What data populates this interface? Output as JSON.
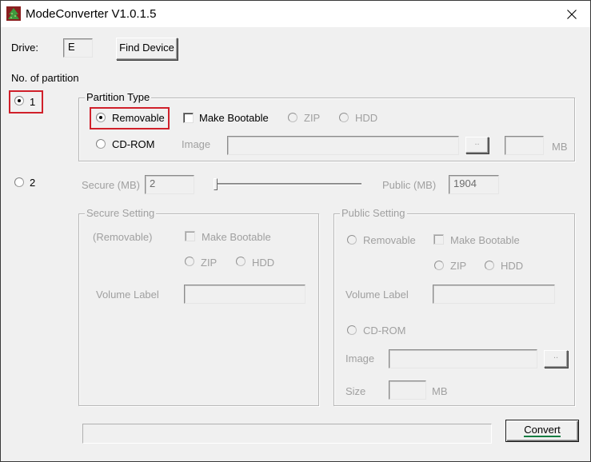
{
  "window": {
    "title": "ModeConverter V1.0.1.5",
    "app_icon": "tree-app-icon",
    "close_icon": "close-icon"
  },
  "drive": {
    "label": "Drive:",
    "value": "E",
    "find_device_label": "Find Device"
  },
  "partition_count": {
    "label": "No. of partition",
    "options": [
      {
        "label": "1",
        "checked": true
      },
      {
        "label": "2",
        "checked": false
      }
    ]
  },
  "partition_type": {
    "title": "Partition Type",
    "removable_label": "Removable",
    "removable_checked": true,
    "make_bootable_label": "Make Bootable",
    "make_bootable_checked": false,
    "zip_label": "ZIP",
    "hdd_label": "HDD",
    "cdrom_label": "CD-ROM",
    "cdrom_checked": false,
    "image_label": "Image",
    "image_value": "",
    "browse_label": "..",
    "size_value": "",
    "size_unit": "MB"
  },
  "two_partition": {
    "secure_label": "Secure (MB)",
    "secure_value": "2",
    "public_label": "Public (MB)",
    "public_value": "1904",
    "slider_fraction": 0.001
  },
  "secure_setting": {
    "title": "Secure Setting",
    "type_label": "(Removable)",
    "make_bootable_label": "Make Bootable",
    "zip_label": "ZIP",
    "hdd_label": "HDD",
    "volume_label_label": "Volume Label",
    "volume_label_value": ""
  },
  "public_setting": {
    "title": "Public Setting",
    "removable_label": "Removable",
    "make_bootable_label": "Make Bootable",
    "zip_label": "ZIP",
    "hdd_label": "HDD",
    "volume_label_label": "Volume Label",
    "volume_label_value": "",
    "cdrom_label": "CD-ROM",
    "image_label": "Image",
    "image_value": "",
    "browse_label": "..",
    "size_label": "Size",
    "size_value": "",
    "size_unit": "MB"
  },
  "footer": {
    "progress": 0,
    "convert_label": "Convert"
  },
  "annotations": {
    "highlight_color": "#d0202a",
    "convert_underline_color": "#107c41"
  }
}
